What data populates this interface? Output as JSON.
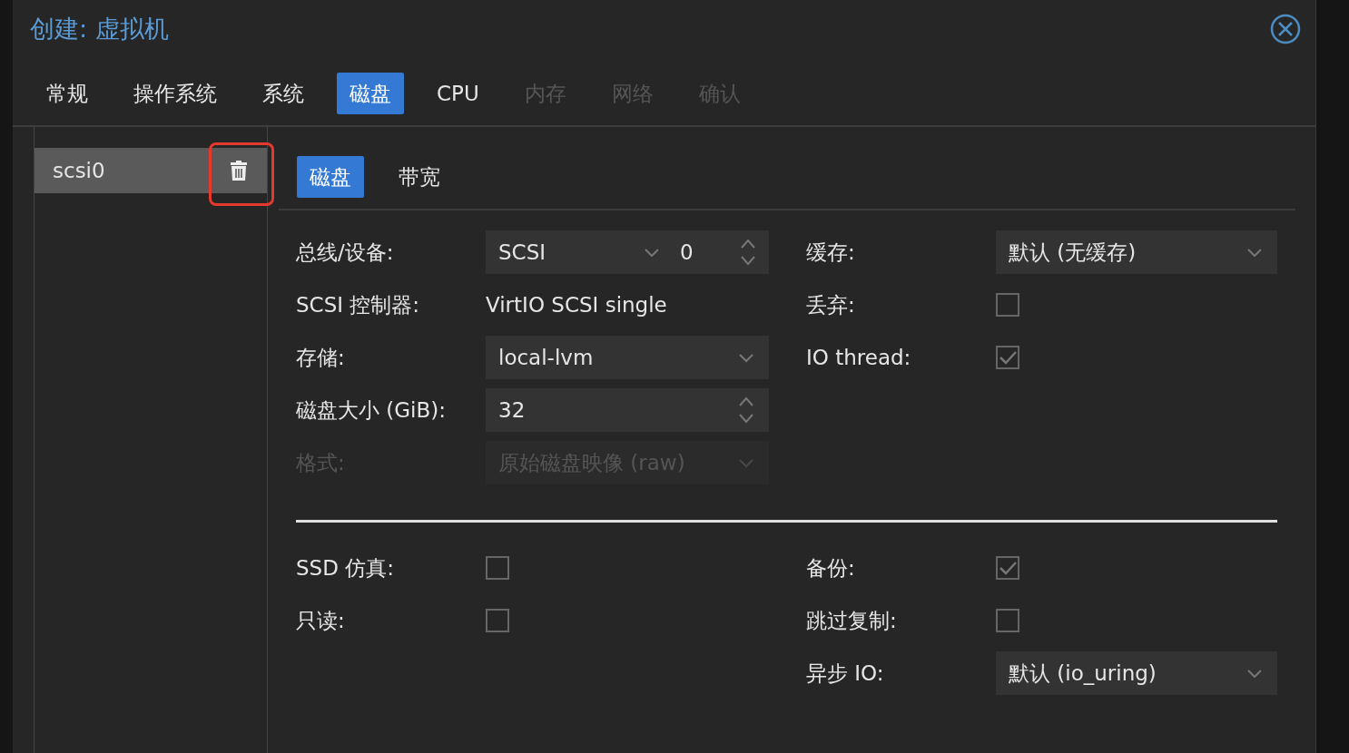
{
  "dialog": {
    "title": "创建: 虚拟机"
  },
  "tabs": [
    {
      "label": "常规",
      "selected": false,
      "disabled": false
    },
    {
      "label": "操作系统",
      "selected": false,
      "disabled": false
    },
    {
      "label": "系统",
      "selected": false,
      "disabled": false
    },
    {
      "label": "磁盘",
      "selected": true,
      "disabled": false
    },
    {
      "label": "CPU",
      "selected": false,
      "disabled": false
    },
    {
      "label": "内存",
      "selected": false,
      "disabled": true
    },
    {
      "label": "网络",
      "selected": false,
      "disabled": true
    },
    {
      "label": "确认",
      "selected": false,
      "disabled": true
    }
  ],
  "disks": {
    "items": [
      {
        "label": "scsi0",
        "selected": true,
        "delete_highlighted": true
      }
    ]
  },
  "subtabs": [
    {
      "label": "磁盘",
      "selected": true
    },
    {
      "label": "带宽",
      "selected": false
    }
  ],
  "form": {
    "left": [
      {
        "kind": "bus",
        "label": "总线/设备:",
        "value": "SCSI",
        "number": "0"
      },
      {
        "kind": "text",
        "label": "SCSI 控制器:",
        "value": "VirtIO SCSI single"
      },
      {
        "kind": "select",
        "label": "存储:",
        "value": "local-lvm",
        "disabled": false
      },
      {
        "kind": "number",
        "label": "磁盘大小 (GiB):",
        "value": "32"
      },
      {
        "kind": "select",
        "label": "格式:",
        "value": "原始磁盘映像 (raw)",
        "disabled": true
      }
    ],
    "right": [
      {
        "kind": "select",
        "label": "缓存:",
        "value": "默认 (无缓存)",
        "disabled": false
      },
      {
        "kind": "checkbox",
        "label": "丢弃:",
        "checked": false
      },
      {
        "kind": "checkbox",
        "label": "IO thread:",
        "checked": true
      }
    ]
  },
  "advanced": {
    "left": [
      {
        "kind": "checkbox",
        "label": "SSD 仿真:",
        "checked": false
      },
      {
        "kind": "checkbox",
        "label": "只读:",
        "checked": false
      }
    ],
    "right": [
      {
        "kind": "checkbox",
        "label": "备份:",
        "checked": true
      },
      {
        "kind": "checkbox",
        "label": "跳过复制:",
        "checked": false
      },
      {
        "kind": "select",
        "label": "异步 IO:",
        "value": "默认 (io_uring)",
        "disabled": false
      }
    ]
  }
}
